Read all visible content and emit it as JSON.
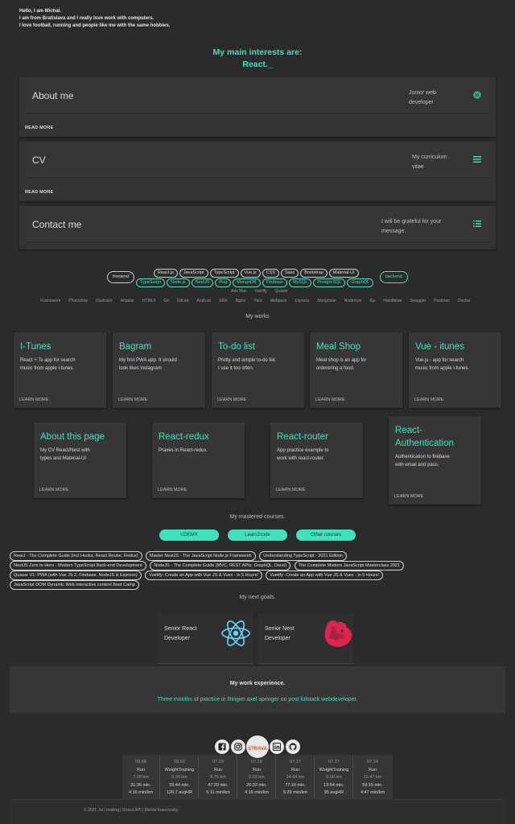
{
  "intro": {
    "line1": "Hello, I am Michal.",
    "line2": "I am from Bratislava and I really love work with computers.",
    "line3": "I love football, running and people like me with the same hobbies."
  },
  "interests": {
    "heading": "My main interests are:",
    "typed": "React._"
  },
  "accordions": [
    {
      "title": "About me",
      "sub": "Junior web developer",
      "icon": "fingerprint-icon",
      "more": "READ MORE"
    },
    {
      "title": "CV",
      "sub": "My curriculum vitae",
      "icon": "list-icon",
      "more": "READ MORE"
    },
    {
      "title": "Contact me",
      "sub": "I will be grateful for your message.",
      "icon": "list-icon"
    }
  ],
  "skills": {
    "frontend": "frontend",
    "backend": "backend",
    "front_row": [
      "React.js",
      "JavaScript",
      "TypeScript",
      "Vue.js",
      "CSS",
      "Sass",
      "Bootstrap",
      "Material-UI"
    ],
    "back_row": [
      "TypeScript",
      "Node.js",
      "NestJS",
      "Pug",
      "MongoDB",
      "Firebase",
      "MySQL",
      "PostgreSQL",
      "GraphQL"
    ],
    "other": [
      "Ads Max",
      "Vuetify",
      "Quasar Framework",
      "Photoshop",
      "Illustrator",
      "Angular",
      "HTML5",
      "Git",
      "GitLab",
      "Android",
      "JIRA",
      "Nginx",
      "Yarn",
      "Webpack",
      "Express",
      "Mongoose",
      "Nodemon",
      "Ejs",
      "Handlebar",
      "Swagger",
      "Postman",
      "Docker"
    ]
  },
  "works": {
    "heading": "My works",
    "cards": [
      {
        "title": "I-Tunes",
        "desc": "React + Ts app for search music from apple i-tunes.",
        "link": "LEARN MORE"
      },
      {
        "title": "Bagram",
        "desc": "My first PWA app. It should look likes instagram",
        "link": "LEARN MORE"
      },
      {
        "title": "To-do list",
        "desc": "Pretty and simple to-do list. I use it too often.",
        "link": "LEARN MORE"
      },
      {
        "title": "Meal Shop",
        "desc": "Meal shop is an app for orderering a food.",
        "link": "LEARN MORE"
      },
      {
        "title": "Vue - itunes",
        "desc": "Vue.js - app for search music from apple i-tunes.",
        "link": "LEARN MORE"
      },
      {
        "title": "About this page",
        "desc": "My CV React/Nest with types and Material-UI",
        "link": "LEARN MORE"
      },
      {
        "title": "React-redux",
        "desc": "Praxes in React-redux.",
        "link": "LEARN MORE"
      },
      {
        "title": "React-router",
        "desc": "App practice example to work with react-router.",
        "link": "LEARN MORE"
      },
      {
        "title": "React-Authentication",
        "desc": "Authentication to firebase with email and pass.",
        "link": "LEARN MORE"
      }
    ]
  },
  "courses": {
    "heading": "My mastered courses.",
    "buttons": [
      "UDEMY",
      "Learn2code",
      "Other courses"
    ],
    "items": [
      "React - The Complete Guide (incl Hooks, React Router, Redux)",
      "Master NestJS - The JavaScript Node.js Framework",
      "Understanding TypeScript - 2021 Edition",
      "NestJS Zero to Hero - Modern TypeScript Back-end Development",
      "NodeJS - The Complete Guide (MVC, REST APIs, GraphQL, Deno)",
      "The Complete Modern JavaScript Masterclass 2021",
      "Quasar V1: PWA (with Vue JS 2, Firebase, NodeJS & Express)",
      "Vuetify: Create an App with Vue JS & Vuex - in 5 Hours!",
      "Vuetify: Create an App with Vue JS & Vuex - in 5 Hours!",
      "JavaScript DOM Dynamic Web interactive content Boot Camp"
    ]
  },
  "goals": {
    "heading": "My next goals.",
    "items": [
      {
        "title": "Senior React Developer",
        "icon": "react-logo-icon"
      },
      {
        "title": "Senior Nest Developer",
        "icon": "nestjs-logo-icon"
      }
    ]
  },
  "experience": {
    "heading": "My work experience.",
    "text": "Three months of practice in Ringier axel springer on post fulstack webdeveloper."
  },
  "social": {
    "strava_label": "STRAVA",
    "icons": [
      "facebook-icon",
      "instagram-icon",
      "strava-icon",
      "linkedin-icon",
      "github-icon"
    ]
  },
  "strava": [
    {
      "date": "08.08",
      "type": "Run",
      "dist": "7.28 km",
      "time": "31:36 min.",
      "pace": "4:16 min/km"
    },
    {
      "date": "08.02",
      "type": "WeightTraining",
      "dist": "0.00 km",
      "time": "39:44 min.",
      "pace": "120.7 avgHR"
    },
    {
      "date": "07.29",
      "type": "Run",
      "dist": "8.75 km",
      "time": "47:20 min.",
      "pace": "5:11 min/km"
    },
    {
      "date": "07.28",
      "type": "Run",
      "dist": "6.33 km",
      "time": "26:32 min.",
      "pace": "4:16 min/km"
    },
    {
      "date": "07.27",
      "type": "Run",
      "dist": "14.04 km",
      "time": "77:10 min.",
      "pace": "5:29 min/km"
    },
    {
      "date": "07.27",
      "type": "WeightTraining",
      "dist": "0.00 km",
      "time": "13:54 min.",
      "pace": "95 avgHR"
    },
    {
      "date": "07.24",
      "type": "Run",
      "dist": "12.47 km",
      "time": "59:15 min.",
      "pace": "4:47 min/km"
    }
  ],
  "footer": {
    "text": "© 2021 Jul | mailing | Strava API | Michal Krasnovsky"
  },
  "colors": {
    "accent": "#3ee3b9",
    "background": "#2b2b2b",
    "card": "#363636",
    "nest": "#e0234e",
    "react": "#61dafb"
  }
}
